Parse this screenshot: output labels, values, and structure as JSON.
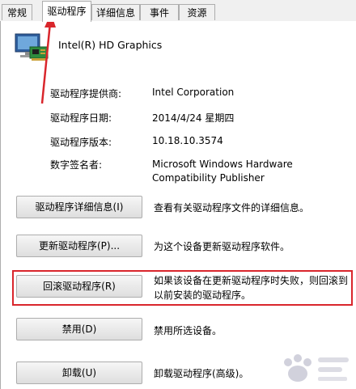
{
  "tabs": [
    {
      "label": "常规"
    },
    {
      "label": "驱动程序",
      "active": true
    },
    {
      "label": "详细信息"
    },
    {
      "label": "事件"
    },
    {
      "label": "资源"
    }
  ],
  "device": {
    "name": "Intel(R) HD Graphics",
    "icon": "display-adapter-icon"
  },
  "info": {
    "provider_label": "驱动程序提供商:",
    "provider_value": "Intel Corporation",
    "date_label": "驱动程序日期:",
    "date_value": "2014/4/24 星期四",
    "version_label": "驱动程序版本:",
    "version_value": "10.18.10.3574",
    "signer_label": "数字签名者:",
    "signer_value": "Microsoft Windows Hardware Compatibility Publisher"
  },
  "actions": {
    "details_button": "驱动程序详细信息(I)",
    "details_desc": "查看有关驱动程序文件的详细信息。",
    "update_button": "更新驱动程序(P)...",
    "update_desc": "为这个设备更新驱动程序软件。",
    "rollback_button": "回滚驱动程序(R)",
    "rollback_desc": "如果该设备在更新驱动程序时失败，则回滚到以前安装的驱动程序。",
    "disable_button": "禁用(D)",
    "disable_desc": "禁用所选设备。",
    "uninstall_button": "卸载(U)",
    "uninstall_desc": "卸载驱动程序(高级)。"
  },
  "annotation": {
    "color": "#d9262c"
  }
}
